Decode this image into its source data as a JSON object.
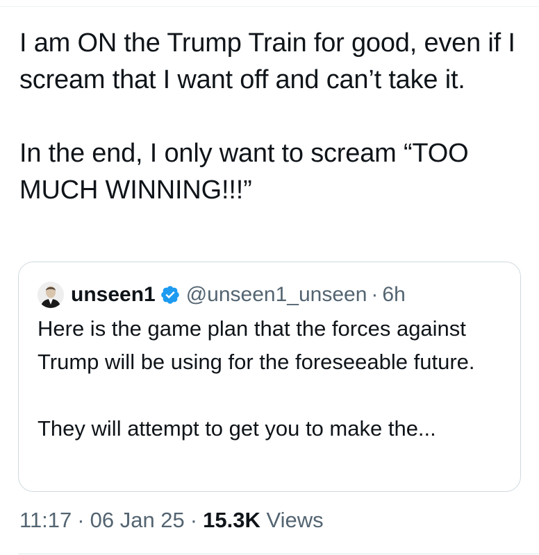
{
  "tweet": {
    "text_paragraph_1": "I am ON the Trump Train for good, even if I scream that I want off and can’t take it.",
    "text_paragraph_2": "In the end, I only want to scream “TOO MUCH WINNING!!!”"
  },
  "quote": {
    "display_name": "unseen1",
    "verified": true,
    "handle": "@unseen1_unseen",
    "separator": "·",
    "time": "6h",
    "text_paragraph_1": "Here is the game plan that the forces against Trump will be using for the foreseeable future.",
    "text_paragraph_2": "They will attempt to get you to make the..."
  },
  "meta": {
    "time": "11:17",
    "separator": "·",
    "date": "06 Jan 25",
    "views_count": "15.3K",
    "views_label": "Views"
  },
  "colors": {
    "text_primary": "#0f1419",
    "text_secondary": "#536471",
    "verified_blue": "#1d9bf0",
    "border": "#cfd9de"
  },
  "icons": {
    "verified": "verified-badge-icon"
  }
}
